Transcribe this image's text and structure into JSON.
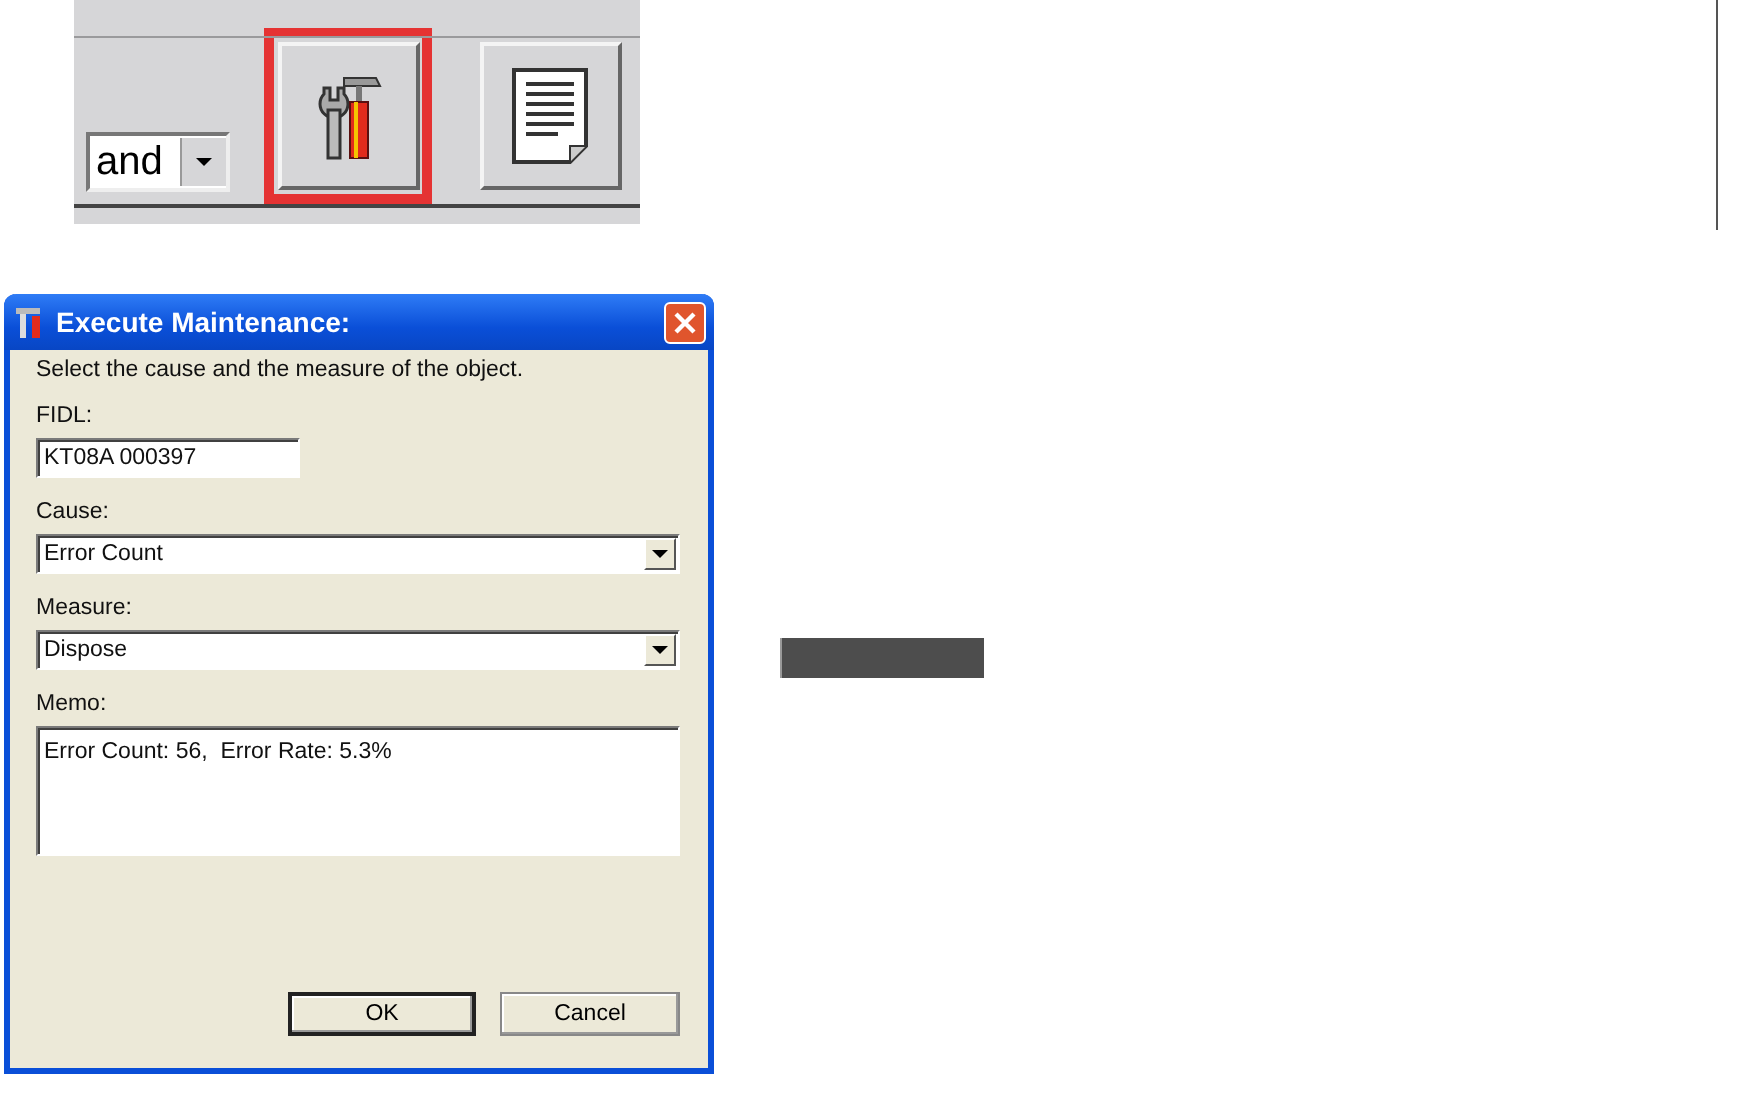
{
  "toolbar": {
    "combo": {
      "value": "and"
    },
    "buttons": [
      {
        "kind": "tools",
        "highlighted": true
      },
      {
        "kind": "document",
        "highlighted": false
      }
    ]
  },
  "dialog": {
    "title": "Execute Maintenance:",
    "instruction": "Select the cause and the measure of the object.",
    "fields": [
      {
        "kind": "text",
        "label": "FIDL:",
        "value": "KT08A 000397"
      },
      {
        "kind": "combo",
        "label": "Cause:",
        "value": "Error Count"
      },
      {
        "kind": "combo",
        "label": "Measure:",
        "value": "Dispose"
      },
      {
        "kind": "memo",
        "label": "Memo:",
        "value": "Error Count: 56,  Error Rate: 5.3%"
      }
    ],
    "buttons": [
      {
        "label": "OK",
        "default": true
      },
      {
        "label": "Cancel",
        "default": false
      }
    ]
  }
}
